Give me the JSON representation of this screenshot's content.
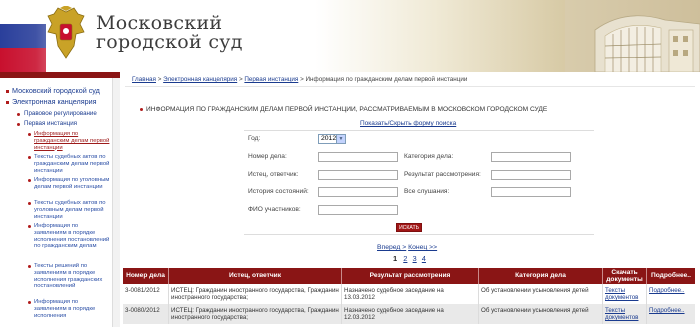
{
  "site": {
    "title_line1": "Московский",
    "title_line2": "городской суд"
  },
  "sidebar": {
    "items": [
      {
        "label": "Московский городской суд"
      },
      {
        "label": "Электронная канцелярия"
      },
      {
        "label": "Правовое регулирование"
      },
      {
        "label": "Первая инстанция"
      }
    ],
    "subitems": [
      {
        "label": "Информация по гражданским делам первой инстанции",
        "active": true
      },
      {
        "label": "Тексты судебных актов по гражданским делам первой инстанции"
      },
      {
        "label": "Информация по уголовным делам первой инстанции"
      },
      {
        "label": "Тексты судебных актов по уголовным делам первой инстанции"
      },
      {
        "label": "Информация по заявлениям в порядке исполнения постановлений по гражданским делам"
      },
      {
        "label": "Тексты решений по заявлениям в порядке исполнения гражданских постановлений"
      },
      {
        "label": "Информация по заявлениям в порядке исполнения"
      }
    ]
  },
  "breadcrumb": {
    "home": "Главная",
    "sep": ">",
    "office": "Электронная канцелярия",
    "first": "Первая инстанция",
    "current": "Информация по гражданским делам первой инстанции"
  },
  "main": {
    "heading": "ИНФОРМАЦИЯ ПО ГРАЖДАНСКИМ ДЕЛАМ ПЕРВОЙ ИНСТАНЦИИ, РАССМАТРИВАЕМЫМ В МОСКОВСКОМ ГОРОДСКОМ СУДЕ",
    "toggle_form": "Показать/Скрыть форму поиска"
  },
  "form": {
    "year_label": "Год:",
    "year_value": "2012",
    "case_number_label": "Номер дела:",
    "case_number_value": "",
    "category_label": "Категория дела:",
    "category_value": "",
    "parties_label": "Истец, ответчик:",
    "parties_value": "",
    "result_label": "Результат рассмотрения:",
    "result_value": "",
    "history_label": "История состояний:",
    "history_value": "",
    "hearings_label": "Все слушания:",
    "hearings_value": "",
    "participants_label": "ФИО участников:",
    "participants_value": "",
    "search_button": "ИСКАТЬ"
  },
  "pager": {
    "forward": "Вперед >",
    "end": "Конец >>",
    "current": "1",
    "pages": [
      "2",
      "3",
      "4"
    ]
  },
  "table": {
    "headers": [
      "Номер дела",
      "Истец, ответчик",
      "Результат рассмотрения",
      "Категория дела",
      "Скачать документы",
      "Подробнее.."
    ],
    "rows": [
      {
        "number": "3-0081/2012",
        "parties": "ИСТЕЦ: Гражданин иностранного государства, Гражданин иностранного государства;",
        "result": "Назначено судебное заседание на 13.03.2012",
        "category": "Об установлении усыновления детей",
        "docs": "Тексты документов",
        "more": "Подробнее.."
      },
      {
        "number": "3-0080/2012",
        "parties": "ИСТЕЦ: Гражданин иностранного государства, Гражданин иностранного государства;",
        "result": "Назначено судебное заседание на 12.03.2012",
        "category": "Об установлении усыновления детей",
        "docs": "Тексты документов",
        "more": "Подробнее.."
      }
    ]
  },
  "colors": {
    "accent": "#8a1515",
    "link": "#1a3b8f",
    "flag_white": "#ffffff",
    "flag_blue": "#2a3f9b",
    "flag_red": "#c8102e"
  }
}
